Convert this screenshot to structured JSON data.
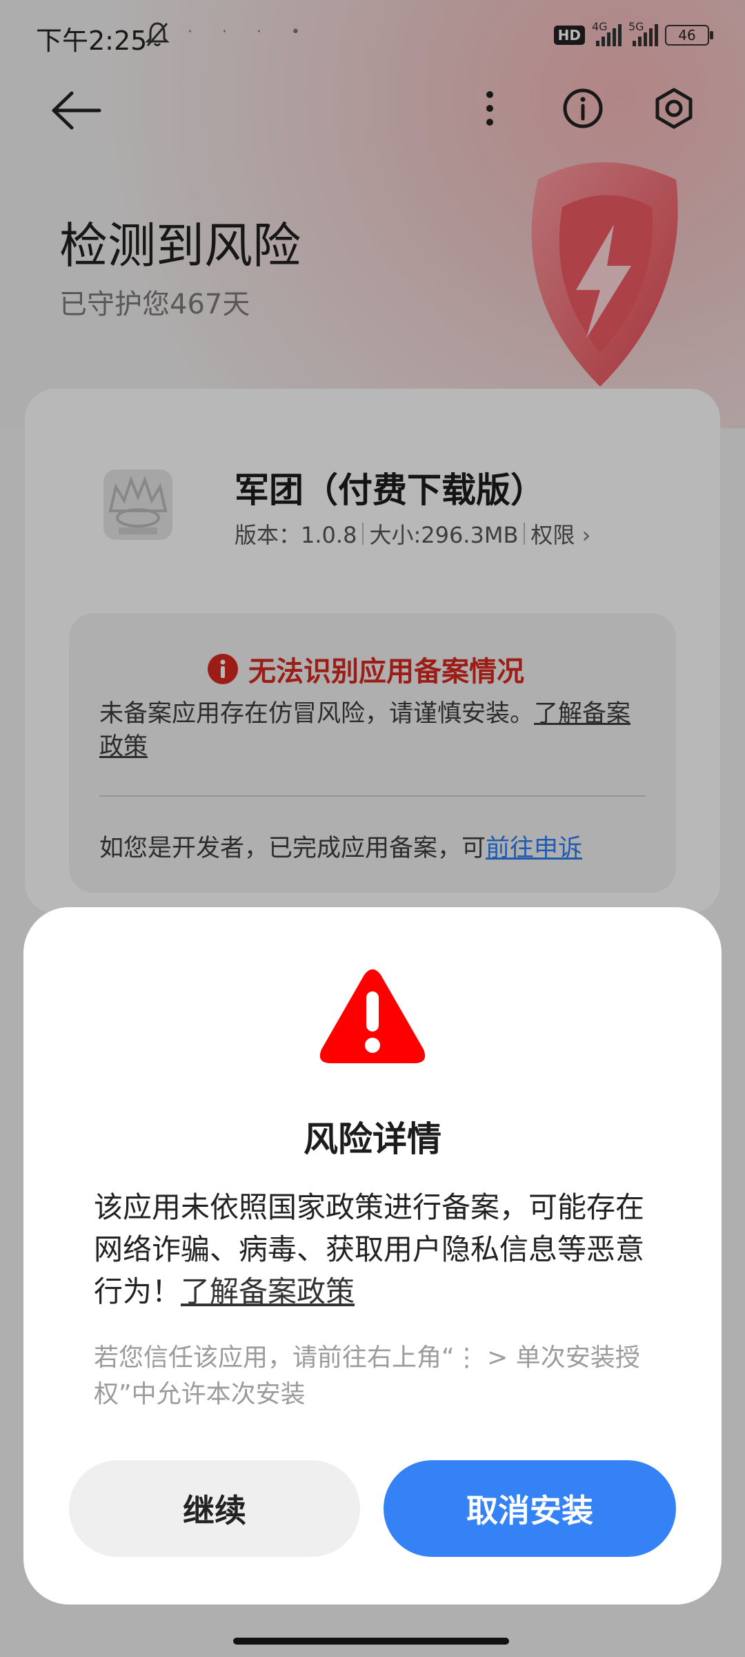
{
  "status_bar": {
    "time": "下午2:25",
    "hd_badge": "HD",
    "network_1": "4G",
    "network_2": "5G",
    "battery": "46"
  },
  "header": {
    "title": "检测到风险",
    "subtitle": "已守护您467天"
  },
  "app": {
    "name": "军团（付费下载版）",
    "version": "版本：1.0.8",
    "size": "大小:296.3MB",
    "permissions": "权限"
  },
  "notice": {
    "title": "无法识别应用备案情况",
    "body": "未备案应用存在仿冒风险，请谨慎安装。",
    "policy_link": "了解备案政策",
    "developer_text": "如您是开发者，已完成应用备案，可",
    "appeal_link": "前往申诉"
  },
  "dialog": {
    "title": "风险详情",
    "body": "该应用未依照国家政策进行备案，可能存在网络诈骗、病毒、获取用户隐私信息等恶意行为！",
    "policy_link": "了解备案政策",
    "hint": "若您信任该应用，请前往右上角“⋮ > 单次安装授权”中允许本次安装",
    "continue_label": "继续",
    "cancel_label": "取消安装"
  },
  "colors": {
    "accent_blue": "#3482f6",
    "danger_red": "#d9281f",
    "warning_red": "#ff0000"
  }
}
